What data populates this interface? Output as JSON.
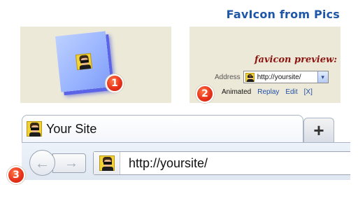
{
  "header": {
    "title": "FavIcon from Pics"
  },
  "badges": {
    "one": "1",
    "two": "2",
    "three": "3"
  },
  "preview": {
    "label": "favicon preview:",
    "address_label": "Address",
    "url": "http://yoursite/",
    "dropdown_glyph": "▾"
  },
  "actions": {
    "animated": "Animated",
    "replay": "Replay",
    "edit": "Edit",
    "close": "[X]"
  },
  "browser": {
    "tab_title": "Your Site",
    "new_tab_glyph": "+",
    "back_glyph": "←",
    "forward_glyph": "→",
    "url": "http://yoursite/"
  },
  "colors": {
    "title": "#1f57a8",
    "preview_label": "#8c1410",
    "badge": "#e8321a",
    "panel_bg": "#ece9d8",
    "link": "#1f4fa8"
  },
  "icons": [
    "favicon-icon",
    "dropdown-arrow-icon",
    "back-arrow-icon",
    "forward-arrow-icon",
    "new-tab-icon"
  ]
}
